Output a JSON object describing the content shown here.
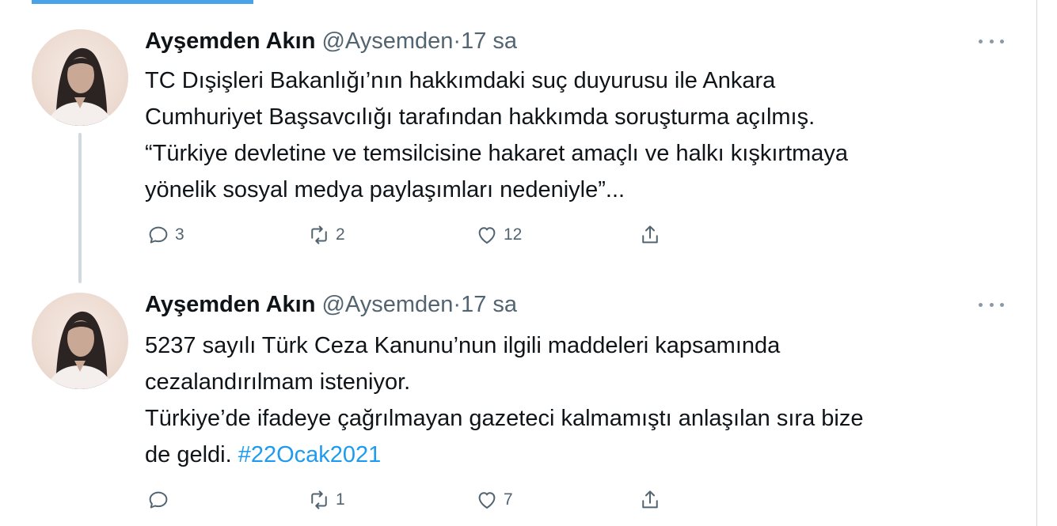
{
  "tweets": [
    {
      "author": {
        "name": "Ayşemden Akın",
        "handle": "@Aysemden",
        "avatar_icon": "profile-photo"
      },
      "separator": "·",
      "time": "17 sa",
      "lines": [
        "TC Dışişleri Bakanlığı’nın hakkımdaki suç duyurusu ile Ankara",
        "Cumhuriyet Başsavcılığı tarafından hakkımda soruşturma açılmış.",
        "“Türkiye devletine ve temsilcisine hakaret amaçlı ve halkı kışkırtmaya",
        "yönelik sosyal medya paylaşımları nedeniyle”..."
      ],
      "actions": {
        "replies": "3",
        "retweets": "2",
        "likes": "12",
        "share_icon": "share-icon"
      }
    },
    {
      "author": {
        "name": "Ayşemden Akın",
        "handle": "@Aysemden",
        "avatar_icon": "profile-photo"
      },
      "separator": "·",
      "time": "17 sa",
      "lines": [
        "5237 sayılı Türk Ceza Kanunu’nun ilgili maddeleri kapsamında",
        "cezalandırılmam isteniyor.",
        "Türkiye’de ifadeye çağrılmayan gazeteci kalmamıştı anlaşılan sıra bize",
        "de geldi."
      ],
      "hashtag": "#22Ocak2021",
      "actions": {
        "replies": "",
        "retweets": "1",
        "likes": "7",
        "share_icon": "share-icon"
      }
    }
  ],
  "colors": {
    "link": "#1d9bf0",
    "secondary_text": "#536471",
    "primary_text": "#0f1419",
    "thread_line": "#cfd9de"
  }
}
